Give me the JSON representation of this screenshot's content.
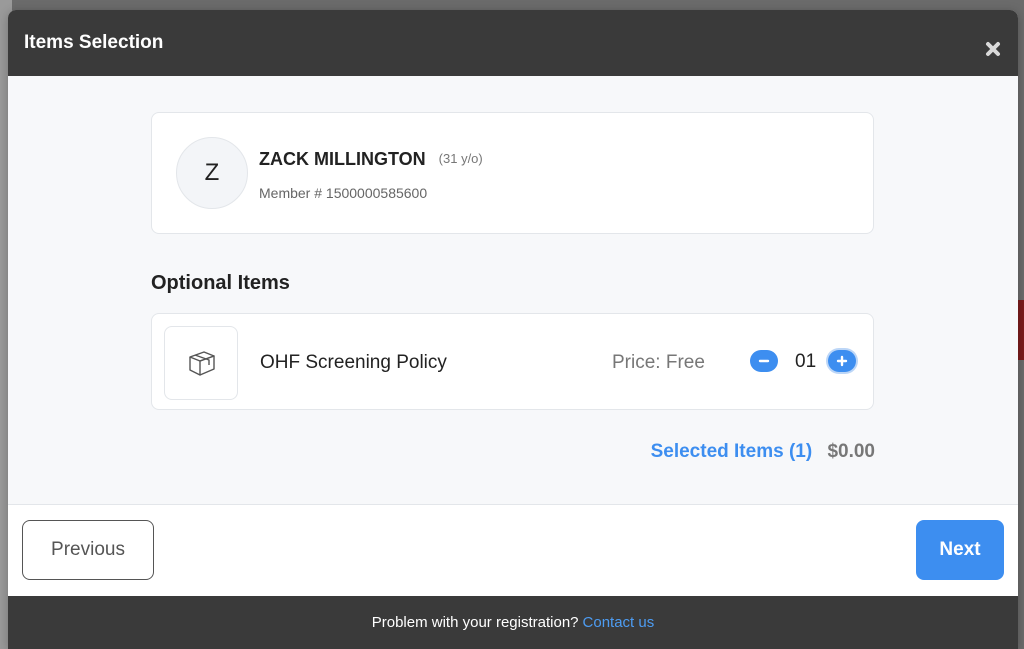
{
  "modal": {
    "title": "Items Selection",
    "close_icon": "close-icon"
  },
  "member": {
    "avatar_initial": "Z",
    "name": "ZACK MILLINGTON",
    "age": "(31 y/o)",
    "member_number": "Member # 1500000585600"
  },
  "optional_items": {
    "section_title": "Optional Items",
    "items": [
      {
        "icon": "box-icon",
        "name": "OHF Screening Policy",
        "price": "Price: Free",
        "quantity": "01"
      }
    ]
  },
  "summary": {
    "selected_label": "Selected Items (1)",
    "total": "$0.00"
  },
  "buttons": {
    "previous": "Previous",
    "next": "Next"
  },
  "footer": {
    "text": "Problem with your registration?",
    "link": "Contact us"
  },
  "colors": {
    "accent": "#3d8ef0",
    "header_bg": "#3a3a3a",
    "footer_link": "#4d9cf2"
  }
}
